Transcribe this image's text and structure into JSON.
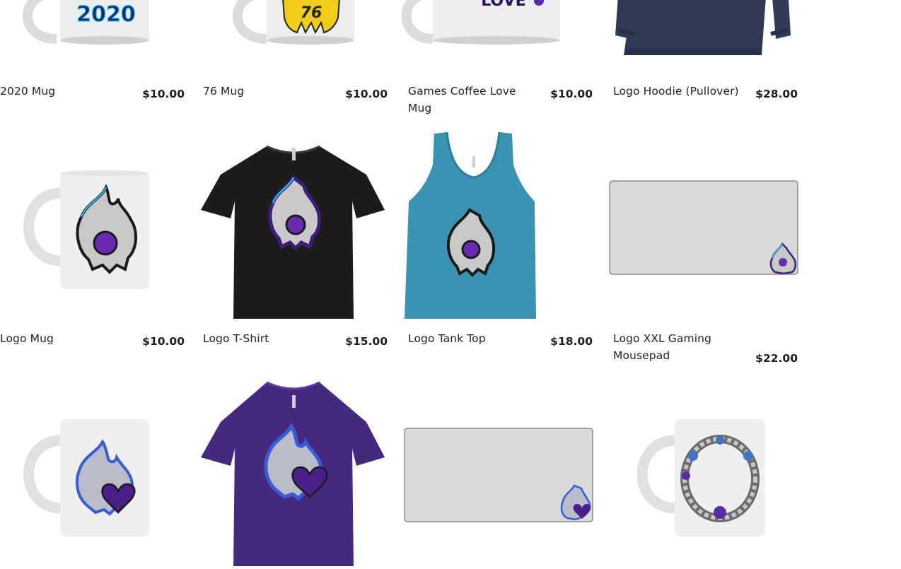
{
  "products": [
    {
      "name": "2020 Mug",
      "price": "$10.00",
      "art": "2020",
      "kind": "mug"
    },
    {
      "name": "76 Mug",
      "price": "$10.00",
      "art": "76",
      "kind": "mug"
    },
    {
      "name": "Games Coffee Love Mug",
      "price": "$10.00",
      "art": "LOVE",
      "kind": "mug"
    },
    {
      "name": "Logo Hoodie (Pullover)",
      "price": "$28.00",
      "kind": "hoodie"
    },
    {
      "name": "Logo Mug",
      "price": "$10.00",
      "kind": "mug"
    },
    {
      "name": "Logo T-Shirt",
      "price": "$15.00",
      "kind": "tshirt",
      "color": "#1d1b1c"
    },
    {
      "name": "Logo Tank Top",
      "price": "$18.00",
      "kind": "tank",
      "color": "#3a93b3"
    },
    {
      "name": "Logo XXL Gaming Mousepad",
      "price": "$22.00",
      "kind": "mousepad"
    },
    {
      "name": "",
      "price": "",
      "kind": "mug-heart"
    },
    {
      "name": "",
      "price": "",
      "kind": "tshirt-heart",
      "color": "#47287f"
    },
    {
      "name": "",
      "price": "",
      "kind": "mousepad-heart"
    },
    {
      "name": "",
      "price": "",
      "kind": "mug-ring"
    }
  ],
  "colors": {
    "accent": "#6a2bb0",
    "mug": "#e6e6e6",
    "hoodie": "#2f3a55",
    "mousepad": "#d8d8d8"
  }
}
